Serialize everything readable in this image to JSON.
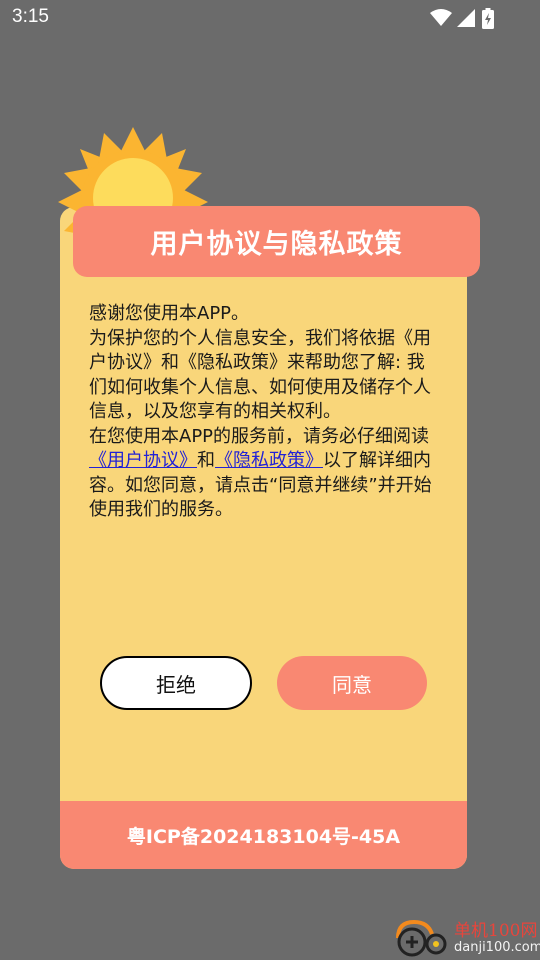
{
  "status_bar": {
    "time": "3:15",
    "icons": [
      "wifi-icon",
      "signal-icon",
      "battery-charging-icon"
    ]
  },
  "dialog": {
    "title": "用户协议与隐私政策",
    "paragraph1": "感谢您使用本APP。",
    "paragraph2": "为保护您的个人信息安全，我们将依据《用户协议》和《隐私政策》来帮助您了解: 我们如何收集个人信息、如何使用及储存个人信息，以及您享有的相关权利。",
    "paragraph3_prefix": "在您使用本APP的服务前，请务必仔细阅读",
    "link_user_agreement": "《用户协议》",
    "paragraph3_and": "和",
    "link_privacy_policy": "《隐私政策》",
    "paragraph3_suffix": "以了解详细内容。如您同意，请点击“同意并继续”并开始使用我们的服务。",
    "reject_label": "拒绝",
    "agree_label": "同意",
    "footer": "粤ICP备2024183104号-45A"
  },
  "watermark": {
    "title": "单机100网",
    "url": "danji100.com"
  },
  "colors": {
    "background": "#6b6b6b",
    "dialog_bg": "#f9d67a",
    "accent": "#f98872",
    "link": "#2222d6",
    "sun": "#fbb531"
  }
}
